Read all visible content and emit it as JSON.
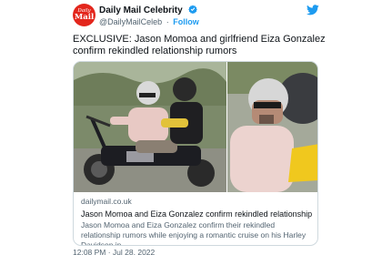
{
  "account": {
    "avatar_line1": "Daily",
    "avatar_line2": "Mail",
    "display_name": "Daily Mail Celebrity",
    "handle": "@DailyMailCeleb",
    "separator": "·",
    "follow_label": "Follow",
    "verified_icon": "verified-badge-icon",
    "brand_icon": "twitter-bird-icon"
  },
  "tweet": {
    "text": "EXCLUSIVE: Jason Momoa and girlfriend Eiza Gonzalez confirm rekindled relationship rumors"
  },
  "card": {
    "domain": "dailymail.co.uk",
    "title": "Jason Momoa and Eiza Gonzalez confirm rekindled relationship rumors",
    "description": "Jason Momoa and Eiza Gonzalez confirm their rekindled relationship rumors while enjoying a romantic cruise on his Harley Davidson in ..."
  },
  "meta": {
    "timestamp": "12:08 PM · Jul 28, 2022"
  },
  "colors": {
    "brand_red": "#e3261c",
    "twitter_blue": "#1d9bf0",
    "text_primary": "#0f1419",
    "text_secondary": "#536471",
    "border": "#cfd9de"
  }
}
